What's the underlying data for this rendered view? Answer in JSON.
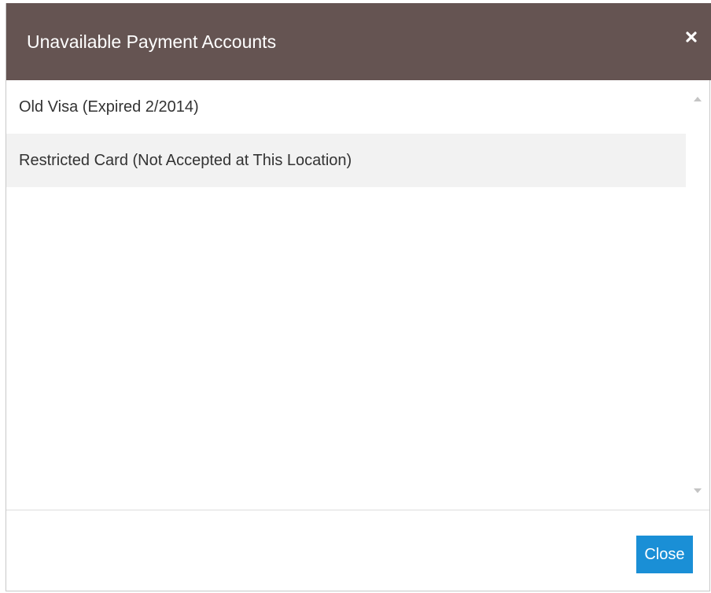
{
  "dialog": {
    "title": "Unavailable Payment Accounts",
    "close_icon": "close-icon",
    "items": [
      {
        "label": "Old Visa (Expired 2/2014)"
      },
      {
        "label": "Restricted Card (Not Accepted at This Location)"
      }
    ],
    "scroll_up_icon": "triangle-up-icon",
    "scroll_down_icon": "triangle-down-icon",
    "close_button_label": "Close"
  },
  "colors": {
    "header_bg": "#655452",
    "accent": "#1a8fd6",
    "alt_row_bg": "#f2f2f2"
  }
}
